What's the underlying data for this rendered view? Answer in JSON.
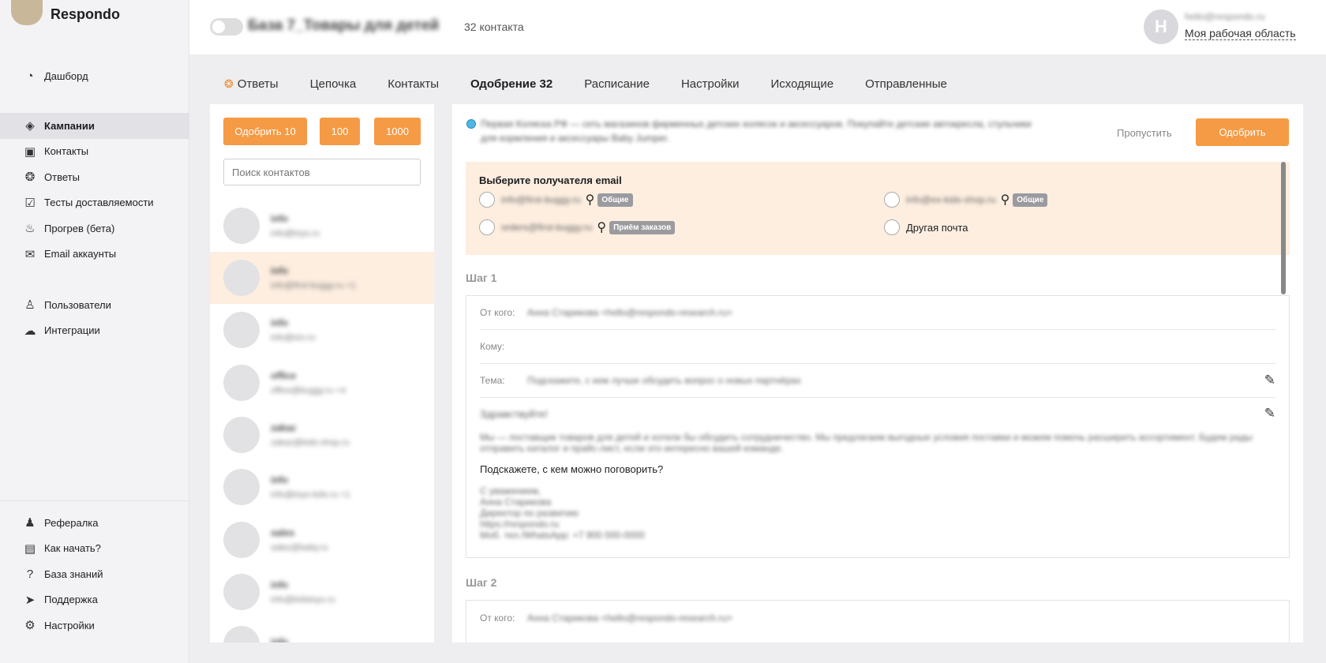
{
  "app": {
    "name": "Respondo"
  },
  "sidebar": {
    "main": [
      {
        "icon": "dashboard-icon",
        "glyph": "◔",
        "label": "Дашборд"
      }
    ],
    "section2": [
      {
        "icon": "campaign-icon",
        "glyph": "◈",
        "label": "Кампании",
        "active": true
      },
      {
        "icon": "contacts-icon",
        "glyph": "▣",
        "label": "Контакты"
      },
      {
        "icon": "replies-icon",
        "glyph": "❂",
        "label": "Ответы"
      },
      {
        "icon": "deliverability-icon",
        "glyph": "☑",
        "label": "Тесты доставляемости"
      },
      {
        "icon": "warmup-icon",
        "glyph": "♨",
        "label": "Прогрев (бета)"
      },
      {
        "icon": "mail-icon",
        "glyph": "✉",
        "label": "Email аккаунты"
      }
    ],
    "section3": [
      {
        "icon": "user-icon",
        "glyph": "♙",
        "label": "Пользователи"
      },
      {
        "icon": "cloud-icon",
        "glyph": "☁",
        "label": "Интеграции"
      }
    ],
    "bottom": [
      {
        "icon": "referral-icon",
        "glyph": "♟",
        "label": "Рефералка"
      },
      {
        "icon": "pdf-icon",
        "glyph": "▤",
        "label": "Как начать?"
      },
      {
        "icon": "help-icon",
        "glyph": "?",
        "label": "База знаний"
      },
      {
        "icon": "telegram-icon",
        "glyph": "➤",
        "label": "Поддержка"
      },
      {
        "icon": "gear-icon",
        "glyph": "⚙",
        "label": "Настройки"
      }
    ]
  },
  "header": {
    "base_name": "База 7_Товары для детей",
    "contacts_count": "32 контакта",
    "avatar_letter": "H",
    "user_email": "hello@respondo.ru",
    "workspace_link": "Моя рабочая область"
  },
  "tabs": [
    {
      "label": "Ответы",
      "icon": true
    },
    {
      "label": "Цепочка"
    },
    {
      "label": "Контакты"
    },
    {
      "label": "Одобрение 32",
      "active": true
    },
    {
      "label": "Расписание"
    },
    {
      "label": "Настройки"
    },
    {
      "label": "Исходящие"
    },
    {
      "label": "Отправленные"
    }
  ],
  "approve_buttons": [
    "Одобрить 10",
    "100",
    "1000"
  ],
  "search": {
    "placeholder": "Поиск контактов"
  },
  "contacts": [
    {
      "name": "info",
      "email": "info@toys.ru"
    },
    {
      "name": "info",
      "email": "info@first-buggy.ru +1",
      "selected": true
    },
    {
      "name": "info",
      "email": "info@sm.ru"
    },
    {
      "name": "office",
      "email": "office@buggy.ru +4"
    },
    {
      "name": "zakaz",
      "email": "zakaz@kids-shop.ru"
    },
    {
      "name": "info",
      "email": "info@toys-kids.ru +1"
    },
    {
      "name": "sales",
      "email": "sales@baby.ru"
    },
    {
      "name": "info",
      "email": "info@kidstoys.ru"
    },
    {
      "name": "info",
      "email": ""
    }
  ],
  "detail": {
    "description": "Первая Коляска РФ — сеть магазинов фирменных детских колясок и аксессуаров. Покупайте детские автокресла, стульчики для кормления и аксессуары Baby Jumper.",
    "skip_label": "Пропустить",
    "approve_label": "Одобрить",
    "recipient_title": "Выберите получателя email",
    "recipients": [
      {
        "email": "info@first-buggy.ru",
        "badge": "Общие"
      },
      {
        "email": "info@ex-kids-shop.ru",
        "badge": "Общие"
      },
      {
        "email": "orders@first-buggy.ru",
        "badge": "Приём заказов"
      },
      {
        "label": "Другая почта"
      }
    ],
    "step1": {
      "label": "Шаг 1",
      "from_label": "От кого:",
      "from_value": "Анна Старикова <hello@respondo-research.ru>",
      "to_label": "Кому:",
      "subject_label": "Тема:",
      "subject_value": "Подскажите, с кем лучше обсудить вопрос о новых партнёрах",
      "greeting": "Здравствуйте!",
      "body_blur_1": "Мы — поставщик товаров для детей и хотели бы обсудить сотрудничество. Мы предлагаем выгодные условия поставки и можем помочь расширить ассортимент.",
      "body_blur_2": "Будем рады отправить каталог и прайс-лист, если это интересно вашей команде.",
      "question": "Подскажете, с кем можно поговорить?",
      "signature": [
        "С уважением,",
        "Анна Старикова",
        "Директор по развитию",
        "https://respondo.ru",
        "Моб. тел./WhatsApp: +7 900 000-0000"
      ]
    },
    "step2": {
      "label": "Шаг 2",
      "from_label": "От кого:",
      "from_value": "Анна Старикова <hello@respondo-research.ru>"
    }
  }
}
